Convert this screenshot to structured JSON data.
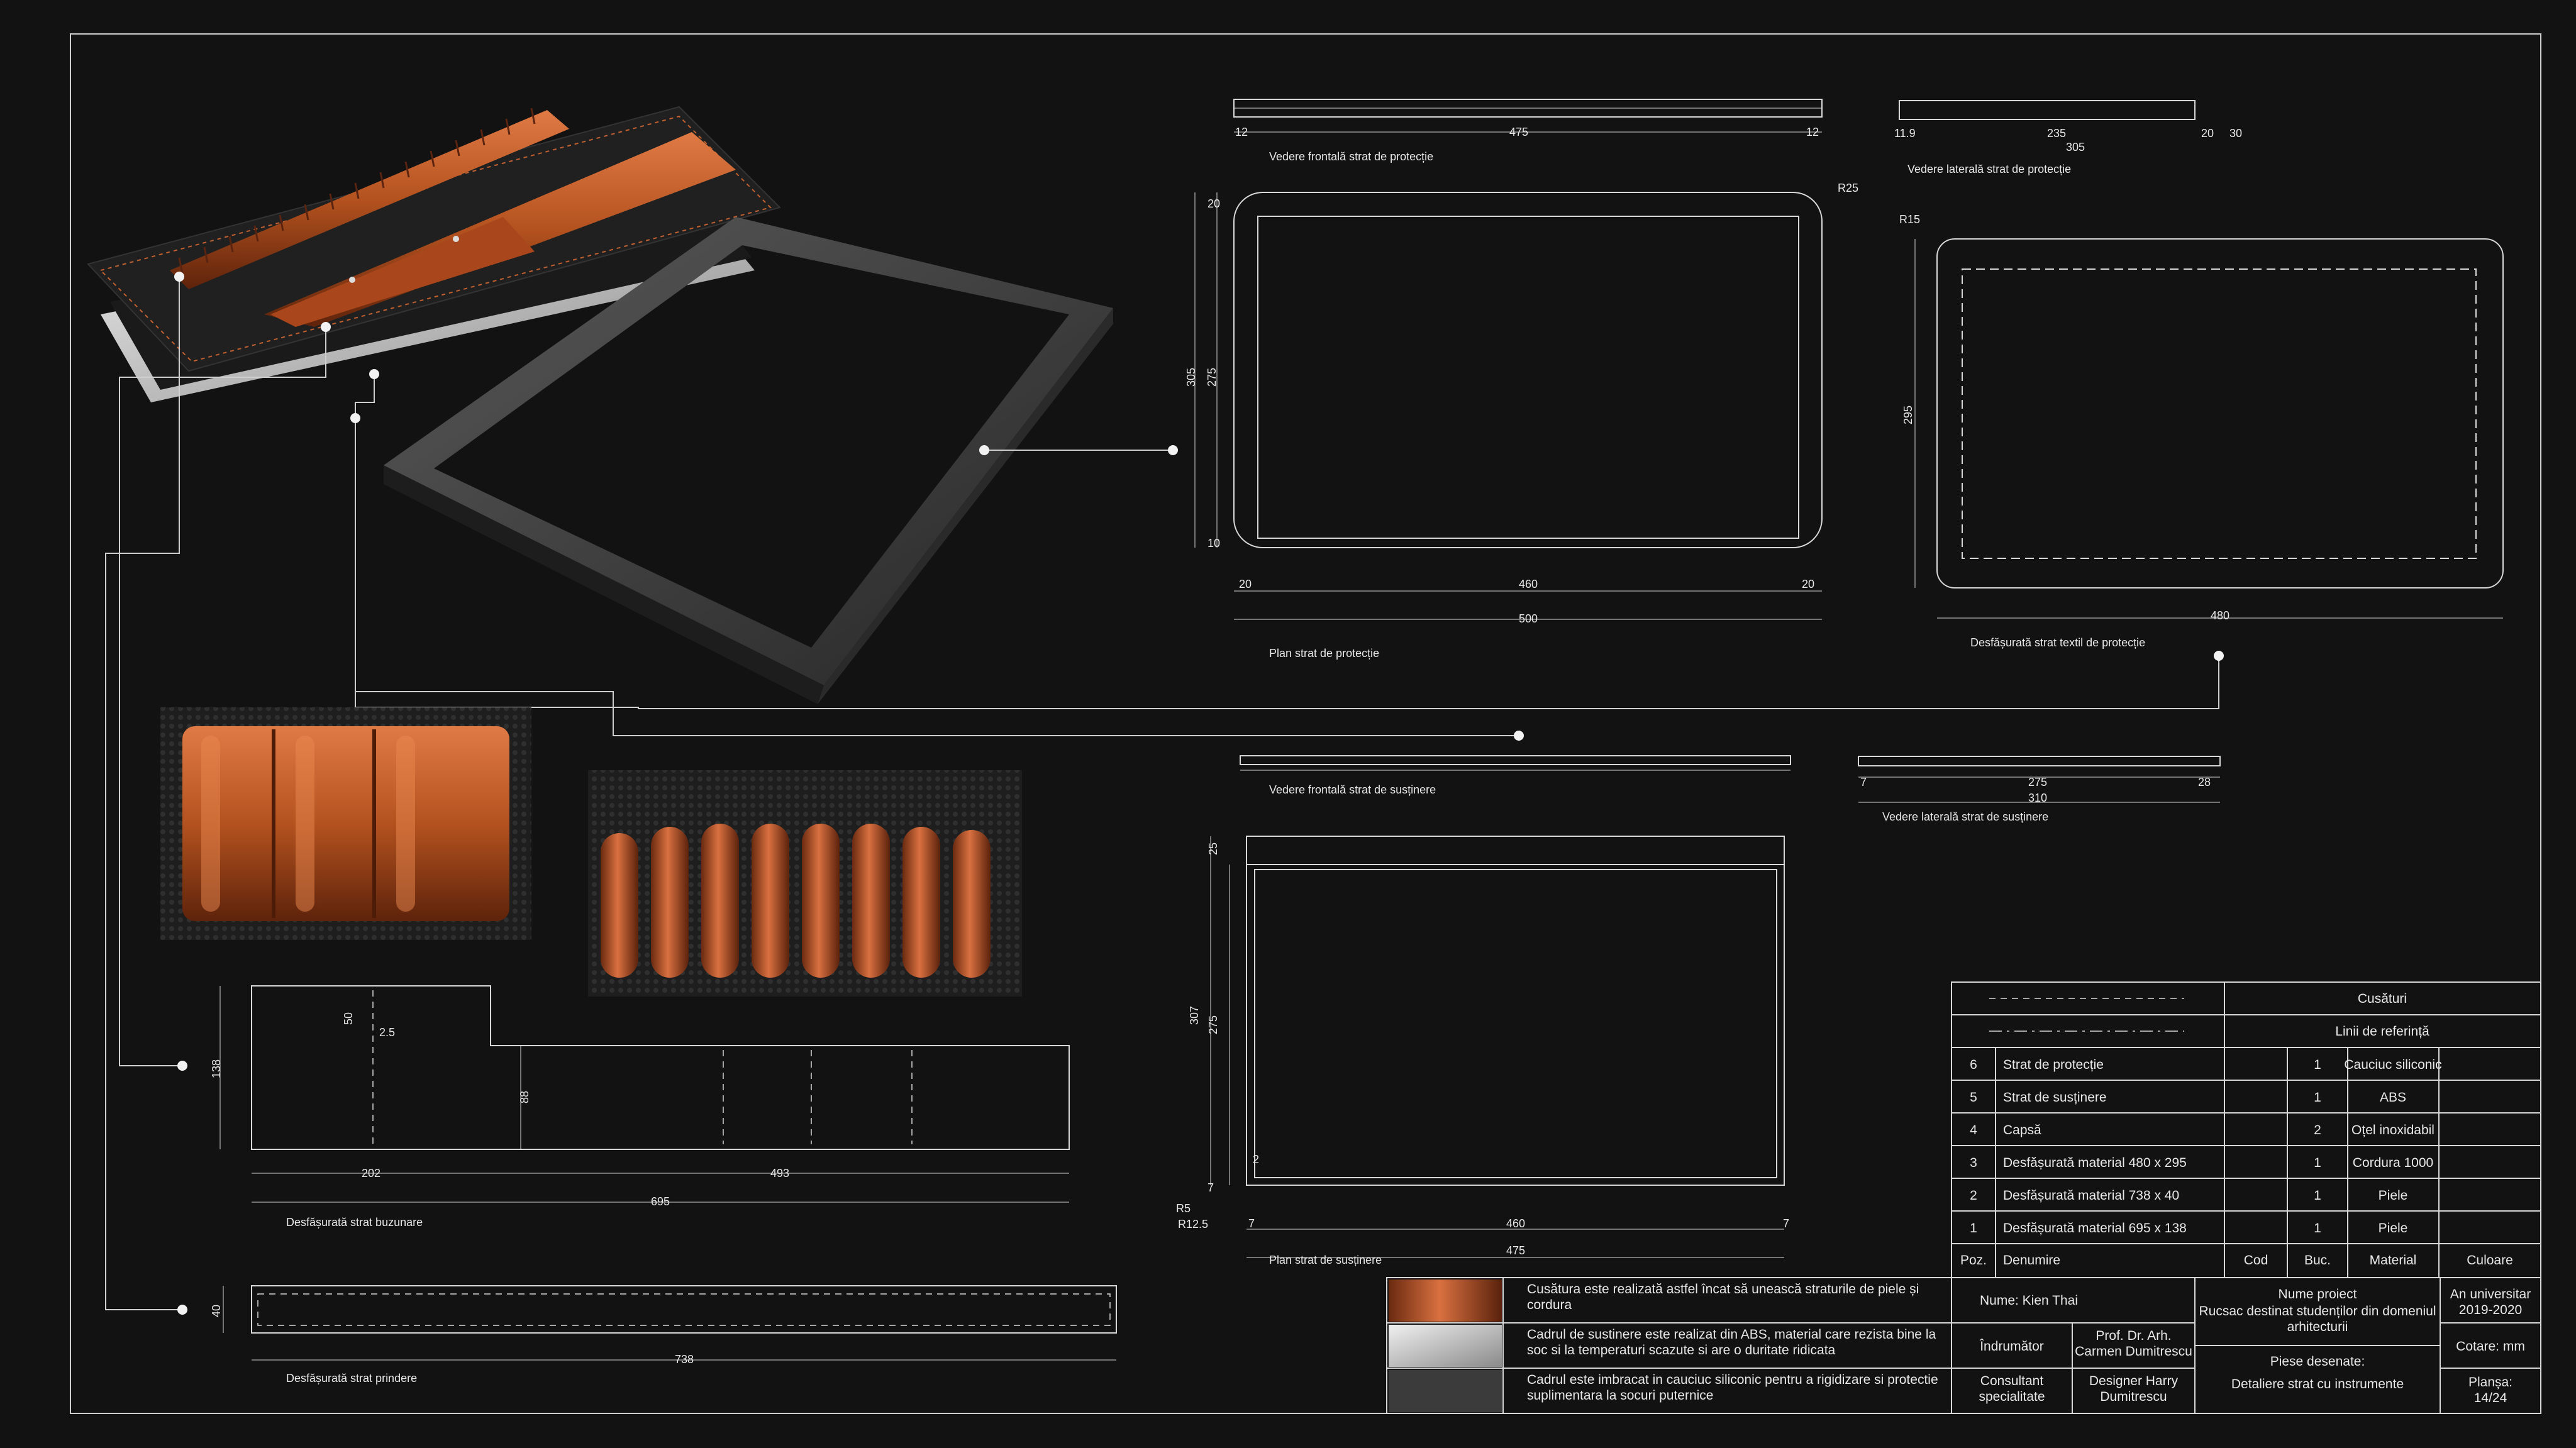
{
  "drawing": {
    "dims": {
      "front_prot": {
        "left": "12",
        "mid": "475",
        "right": "12"
      },
      "side_prot": {
        "a": "11.9",
        "b": "235",
        "c": "20",
        "d": "30",
        "total": "305"
      },
      "plan_prot": {
        "r": "R25",
        "top": "20",
        "h1": "305",
        "h2": "275",
        "bot": "10",
        "w_left": "20",
        "w_mid": "460",
        "w_right": "20",
        "w_total": "500"
      },
      "textile": {
        "r": "R15",
        "h": "295",
        "w": "480"
      },
      "front_sup": {},
      "side_sup": {
        "a": "7",
        "b": "275",
        "c": "28",
        "total": "310"
      },
      "plan_sup": {
        "top": "25",
        "h1": "307",
        "h2": "275",
        "b1": "7",
        "r5": "R5",
        "r125": "R12.5",
        "r2": "2",
        "w_left": "7",
        "w_mid": "460",
        "w_right": "7",
        "w_total": "475"
      },
      "pockets": {
        "a": "50",
        "b": "2.5",
        "h": "138",
        "h2": "88",
        "w1": "202",
        "w2": "493",
        "total": "695"
      },
      "prindere": {
        "h": "40",
        "w": "738"
      }
    },
    "captions": {
      "front_prot": "Vedere frontală strat de protecție",
      "side_prot": "Vedere laterală strat de protecție",
      "plan_prot": "Plan strat de protecție",
      "textile": "Desfășurată strat textil de protecție",
      "front_sup": "Vedere frontală strat de susținere",
      "side_sup": "Vedere laterală strat de susținere",
      "plan_sup": "Plan strat de susținere",
      "pockets": "Desfășurată strat buzunare",
      "prindere": "Desfășurată strat prindere"
    }
  },
  "legend": {
    "seams": "Cusături",
    "reference": "Linii de referință",
    "rows": [
      {
        "poz": "6",
        "name": "Strat de protecție",
        "cod": "",
        "buc": "1",
        "material": "Cauciuc siliconic",
        "color": ""
      },
      {
        "poz": "5",
        "name": "Strat de susținere",
        "cod": "",
        "buc": "1",
        "material": "ABS",
        "color": ""
      },
      {
        "poz": "4",
        "name": "Capsă",
        "cod": "",
        "buc": "2",
        "material": "Oțel inoxidabil",
        "color": ""
      },
      {
        "poz": "3",
        "name": "Desfășurată material 480 x 295",
        "cod": "",
        "buc": "1",
        "material": "Cordura 1000",
        "color": ""
      },
      {
        "poz": "2",
        "name": "Desfășurată material 738 x 40",
        "cod": "",
        "buc": "1",
        "material": "Piele",
        "color": ""
      },
      {
        "poz": "1",
        "name": "Desfășurată material 695 x 138",
        "cod": "",
        "buc": "1",
        "material": "Piele",
        "color": ""
      }
    ],
    "header": {
      "poz": "Poz.",
      "name": "Denumire",
      "cod": "Cod",
      "buc": "Buc.",
      "material": "Material",
      "color": "Culoare"
    }
  },
  "notes": [
    "Cusătura este realizată astfel încat să unească straturile de piele și cordura",
    "Cadrul de sustinere este realizat din ABS, material care rezista bine la soc si la temperaturi scazute si are o duritate ridicata",
    "Cadrul este imbracat in cauciuc siliconic pentru a rigidizare si protectie suplimentara la socuri puternice"
  ],
  "title_block": {
    "name": "Nume: Kien Thai",
    "indrumator": "Îndrumător",
    "prof": "Prof. Dr. Arh. Carmen Dumitrescu",
    "consultant": "Consultant specialitate",
    "designer": "Designer Harry Dumitrescu",
    "project_label": "Nume proiect",
    "project": "Rucsac destinat studenților din domeniul arhitecturii",
    "pieces_label": "Piese desenate:",
    "pieces": "Detaliere strat cu instrumente",
    "year_label": "An universitar",
    "year": "2019-2020",
    "cotare": "Cotare: mm",
    "plansa_label": "Planșa:",
    "plansa": "14/24"
  },
  "colors": {
    "background": "#121212",
    "line": "#d8d8d8",
    "leather": "#b8562a",
    "frame": "#3a3a3a"
  }
}
